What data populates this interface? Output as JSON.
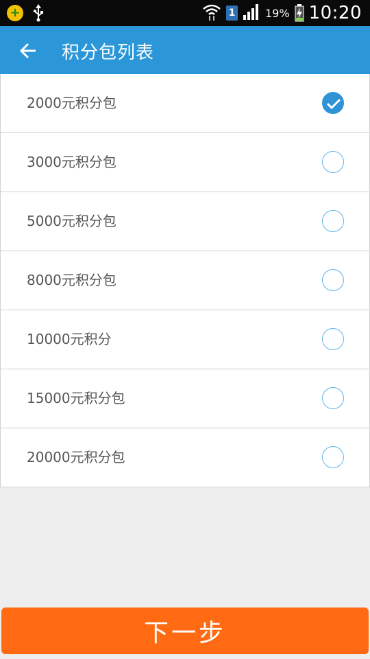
{
  "status_bar": {
    "sim_slot": "1",
    "battery_percent": "19%",
    "time": "10:20",
    "icons": [
      "app-badge-icon",
      "usb-icon",
      "wifi-icon",
      "sim-icon",
      "signal-icon",
      "battery-charging-icon"
    ]
  },
  "app_bar": {
    "title": "积分包列表",
    "back_icon": "arrow-left-icon"
  },
  "packages": [
    {
      "label": "2000元积分包",
      "selected": true
    },
    {
      "label": "3000元积分包",
      "selected": false
    },
    {
      "label": "5000元积分包",
      "selected": false
    },
    {
      "label": "8000元积分包",
      "selected": false
    },
    {
      "label": "10000元积分",
      "selected": false
    },
    {
      "label": "15000元积分包",
      "selected": false
    },
    {
      "label": "20000元积分包",
      "selected": false
    }
  ],
  "footer": {
    "next_label": "下一步"
  },
  "colors": {
    "status_bar": "#0a0a0a",
    "app_bar": "#2b97d8",
    "radio_checked": "#2f93d6",
    "radio_border": "#5db4ea",
    "next_button": "#ff6a13",
    "page_background": "#eeeeee"
  }
}
